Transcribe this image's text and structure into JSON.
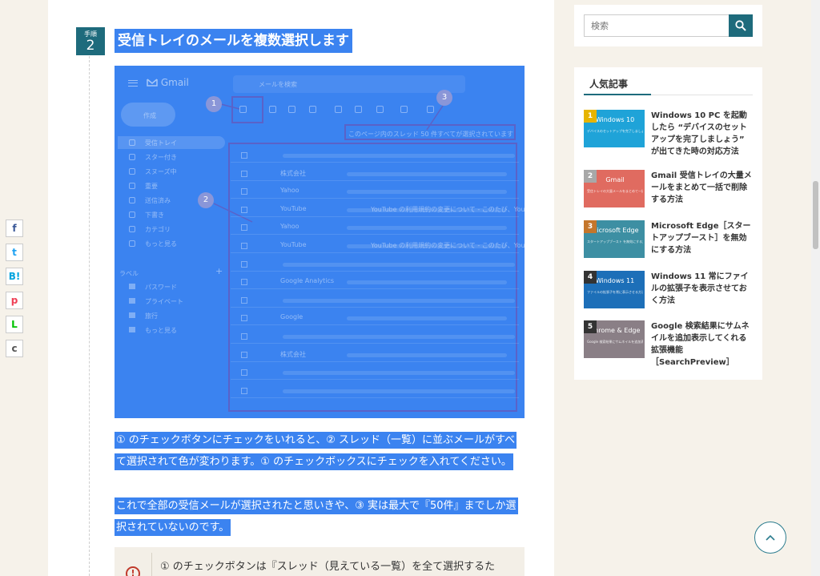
{
  "step": {
    "label": "手順",
    "number": "2"
  },
  "heading": "受信トレイのメールを複数選択します",
  "figure": {
    "app_name": "Gmail",
    "search_placeholder": "メールを検索",
    "compose": "作成",
    "nav": [
      "受信トレイ",
      "スター付き",
      "スヌーズ中",
      "重要",
      "送信済み",
      "下書き",
      "カテゴリ",
      "もっと見る"
    ],
    "labels_header": "ラベル",
    "labels": [
      "パスワード",
      "プライベート",
      "旅行",
      "もっと見る"
    ],
    "banner": "このページ内のスレッド 50 件すべてが選択されています",
    "senders": [
      "",
      "株式会社",
      "Yahoo",
      "YouTube",
      "Yahoo",
      "YouTube",
      "",
      "Google Analytics",
      "",
      "Google",
      "",
      "株式会社",
      "",
      ""
    ],
    "subjects": [
      "",
      "",
      "",
      "YouTube の利用規約の変更について - このたび、You",
      "",
      "YouTube の利用規約の変更について - このたび、You",
      "",
      "",
      "",
      "",
      "",
      "",
      "",
      ""
    ],
    "callouts": [
      "1",
      "2",
      "3"
    ]
  },
  "paragraph1": "① のチェックボタンにチェックをいれると、② スレッド（一覧）に並ぶメールがすべて選択されて色が変わります。① のチェックボックスにチェックを入れてください。",
  "paragraph2": "これで全部の受信メールが選択されたと思いきや、③ 実は最大で『50件』までしか選択されていないのです。",
  "note": {
    "icon": "!",
    "text": "① のチェックボタンは『スレッド（見えている一覧）を全て選択するた"
  },
  "share": {
    "buttons": [
      {
        "name": "facebook",
        "glyph": "f",
        "color": "#3b5998"
      },
      {
        "name": "twitter",
        "glyph": "t",
        "color": "#1da1f2"
      },
      {
        "name": "hatena",
        "glyph": "B!",
        "color": "#00a4de"
      },
      {
        "name": "pocket",
        "glyph": "p",
        "color": "#ef4056"
      },
      {
        "name": "line",
        "glyph": "L",
        "color": "#00c300"
      },
      {
        "name": "copy",
        "glyph": "c",
        "color": "#555555"
      }
    ]
  },
  "sidebar": {
    "search_placeholder": "検索",
    "popular_title": "人気記事",
    "items": [
      {
        "rank": "1",
        "thumb_title": "Windows 10",
        "thumb_sub": "デバイスのセットアップを完了しましょう",
        "thumb_color": "#1fa3d8",
        "rank_color": "#e6b400",
        "text": "Windows 10 PC を起動したら “デバイスのセットアップを完了しましょう” が出てきた時の対応方法"
      },
      {
        "rank": "2",
        "thumb_title": "Gmail",
        "thumb_sub": "受信トレイの大量メールをまとめて一括で削除する方法",
        "thumb_color": "#e06b60",
        "rank_color": "#a8a8a8",
        "text": "Gmail 受信トレイの大量メールをまとめて一括で削除する方法"
      },
      {
        "rank": "3",
        "thumb_title": "Microsoft Edge",
        "thumb_sub": "スタートアップブースト を無効にする方法",
        "thumb_color": "#3d8fa3",
        "rank_color": "#c4762b",
        "text": "Microsoft Edge［スタートアップブースト］を無効にする方法"
      },
      {
        "rank": "4",
        "thumb_title": "Windows 11",
        "thumb_sub": "ファイルの拡張子を常に表示させる方法",
        "thumb_color": "#1d6fb8",
        "rank_color": "#333333",
        "text": "Windows 11 常にファイルの拡張子を表示させておく方法"
      },
      {
        "rank": "5",
        "thumb_title": "Chrome & Edge",
        "thumb_sub": "Google 検索結果にサムネイルを追加表示",
        "thumb_color": "#8a7f86",
        "rank_color": "#333333",
        "text": "Google 検索結果にサムネイルを追加表示してくれる拡張機能［SearchPreview］"
      }
    ]
  },
  "scroll_top_icon": "chevron-up-icon"
}
